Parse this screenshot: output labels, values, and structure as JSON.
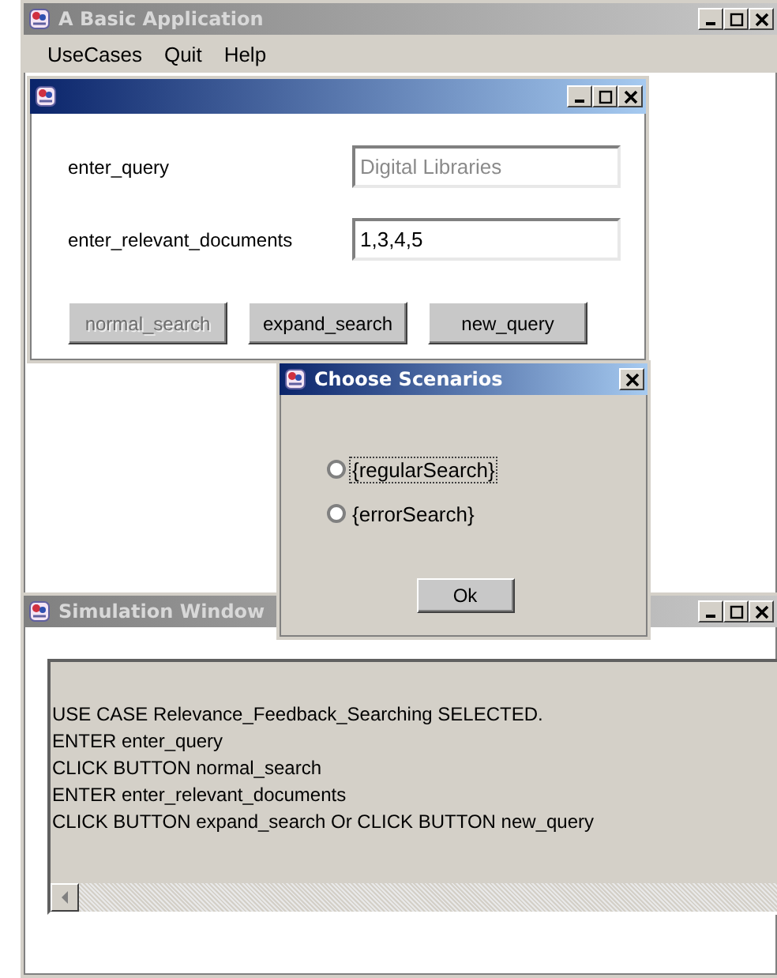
{
  "main_window": {
    "title": "A Basic Application",
    "active": false
  },
  "menu": [
    "UseCases",
    "Quit",
    "Help"
  ],
  "form_window": {
    "active": true,
    "fields": [
      {
        "label": "enter_query",
        "value": "Digital Libraries",
        "disabled": true
      },
      {
        "label": "enter_relevant_documents",
        "value": "1,3,4,5",
        "disabled": false
      }
    ],
    "buttons": [
      {
        "label": "normal_search",
        "disabled": true
      },
      {
        "label": "expand_search",
        "disabled": false
      },
      {
        "label": "new_query",
        "disabled": false
      }
    ]
  },
  "dialog": {
    "title": "Choose Scenarios",
    "active": true,
    "options": [
      {
        "label": "{regularSearch}",
        "selected": false,
        "focused": true
      },
      {
        "label": "{errorSearch}",
        "selected": false,
        "focused": false
      }
    ],
    "button": "Ok"
  },
  "simulation_window": {
    "title": "Simulation Window",
    "active": false,
    "lines": [
      "USE CASE Relevance_Feedback_Searching SELECTED.",
      "ENTER enter_query",
      "CLICK BUTTON  normal_search",
      "ENTER enter_relevant_documents",
      "CLICK BUTTON  expand_search Or CLICK BUTTON  new_query"
    ]
  }
}
